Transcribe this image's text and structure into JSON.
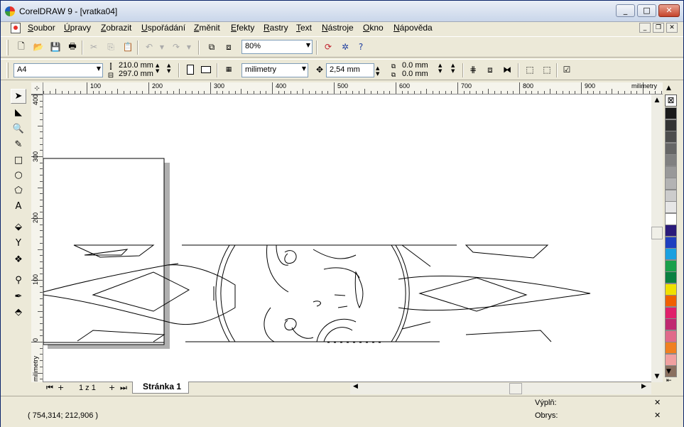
{
  "window": {
    "title": "CorelDRAW 9 - [vratka04]",
    "min_symbol": "_",
    "max_symbol": "□",
    "close_symbol": "✕"
  },
  "menu": {
    "items": [
      "Soubor",
      "Úpravy",
      "Zobrazit",
      "Uspořádání",
      "Změnit",
      "Efekty",
      "Rastry",
      "Text",
      "Nástroje",
      "Okno",
      "Nápověda"
    ],
    "mdi_min": "_",
    "mdi_restore": "❐",
    "mdi_close": "✕"
  },
  "toolbar_standard": {
    "zoom_value": "80%"
  },
  "property_bar": {
    "page_size": "A4",
    "width": "210.0 mm",
    "height": "297.0 mm",
    "units": "milimetry",
    "nudge": "2,54 mm",
    "dup_x": "0.0 mm",
    "dup_y": "0.0 mm"
  },
  "ruler": {
    "units_label": "milimetry",
    "h_labels": [
      "100",
      "200",
      "300",
      "400",
      "500",
      "600",
      "700",
      "800",
      "900"
    ],
    "v_labels": [
      "400",
      "300",
      "200",
      "100",
      "0"
    ]
  },
  "page_nav": {
    "page_count": "1 z 1",
    "tab_label": "Stránka 1"
  },
  "status": {
    "coordinates": "( 754,314; 212,906 )",
    "fill_label": "Výplň:",
    "outline_label": "Obrys:"
  },
  "palette": {
    "colors": [
      "#1a1a1a",
      "#333333",
      "#4d4d4d",
      "#666666",
      "#808080",
      "#999999",
      "#b3b3b3",
      "#cccccc",
      "#e6e6e6",
      "#ffffff",
      "#2a1a7a",
      "#1e3fbf",
      "#1aa0e0",
      "#1aa04a",
      "#0a8040",
      "#f0e000",
      "#f06000",
      "#e0206a",
      "#c02870",
      "#e06a8a",
      "#f08020",
      "#f0a0a0",
      "#8a7060"
    ]
  }
}
